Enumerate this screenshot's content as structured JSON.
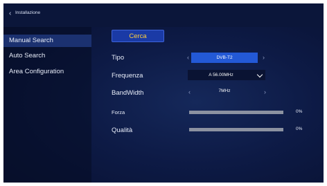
{
  "header": {
    "title": "Installazione"
  },
  "sidebar": {
    "items": [
      {
        "label": "Manual Search",
        "active": true
      },
      {
        "label": "Auto Search",
        "active": false
      },
      {
        "label": "Area Configuration",
        "active": false
      }
    ]
  },
  "main": {
    "cerca_label": "Cerca",
    "tipo": {
      "label": "Tipo",
      "value": "DVB-T2"
    },
    "frequenza": {
      "label": "Frequenza",
      "value": "A 56.00MHz"
    },
    "bandwidth": {
      "label": "BandWidth",
      "value": "7MHz"
    },
    "forza": {
      "label": "Forza",
      "percent_text": "0%",
      "level": 0
    },
    "qualita": {
      "label": "Qualità",
      "percent_text": "0%",
      "level": 0
    }
  },
  "colors": {
    "accent": "#2359d6",
    "button_text": "#ffcf3c",
    "active_item": "#1b3170",
    "bar_track": "#8c92a1"
  },
  "icons": [
    "back-chevron-icon",
    "chevron-left-icon",
    "chevron-right-icon",
    "chevron-down-icon"
  ]
}
